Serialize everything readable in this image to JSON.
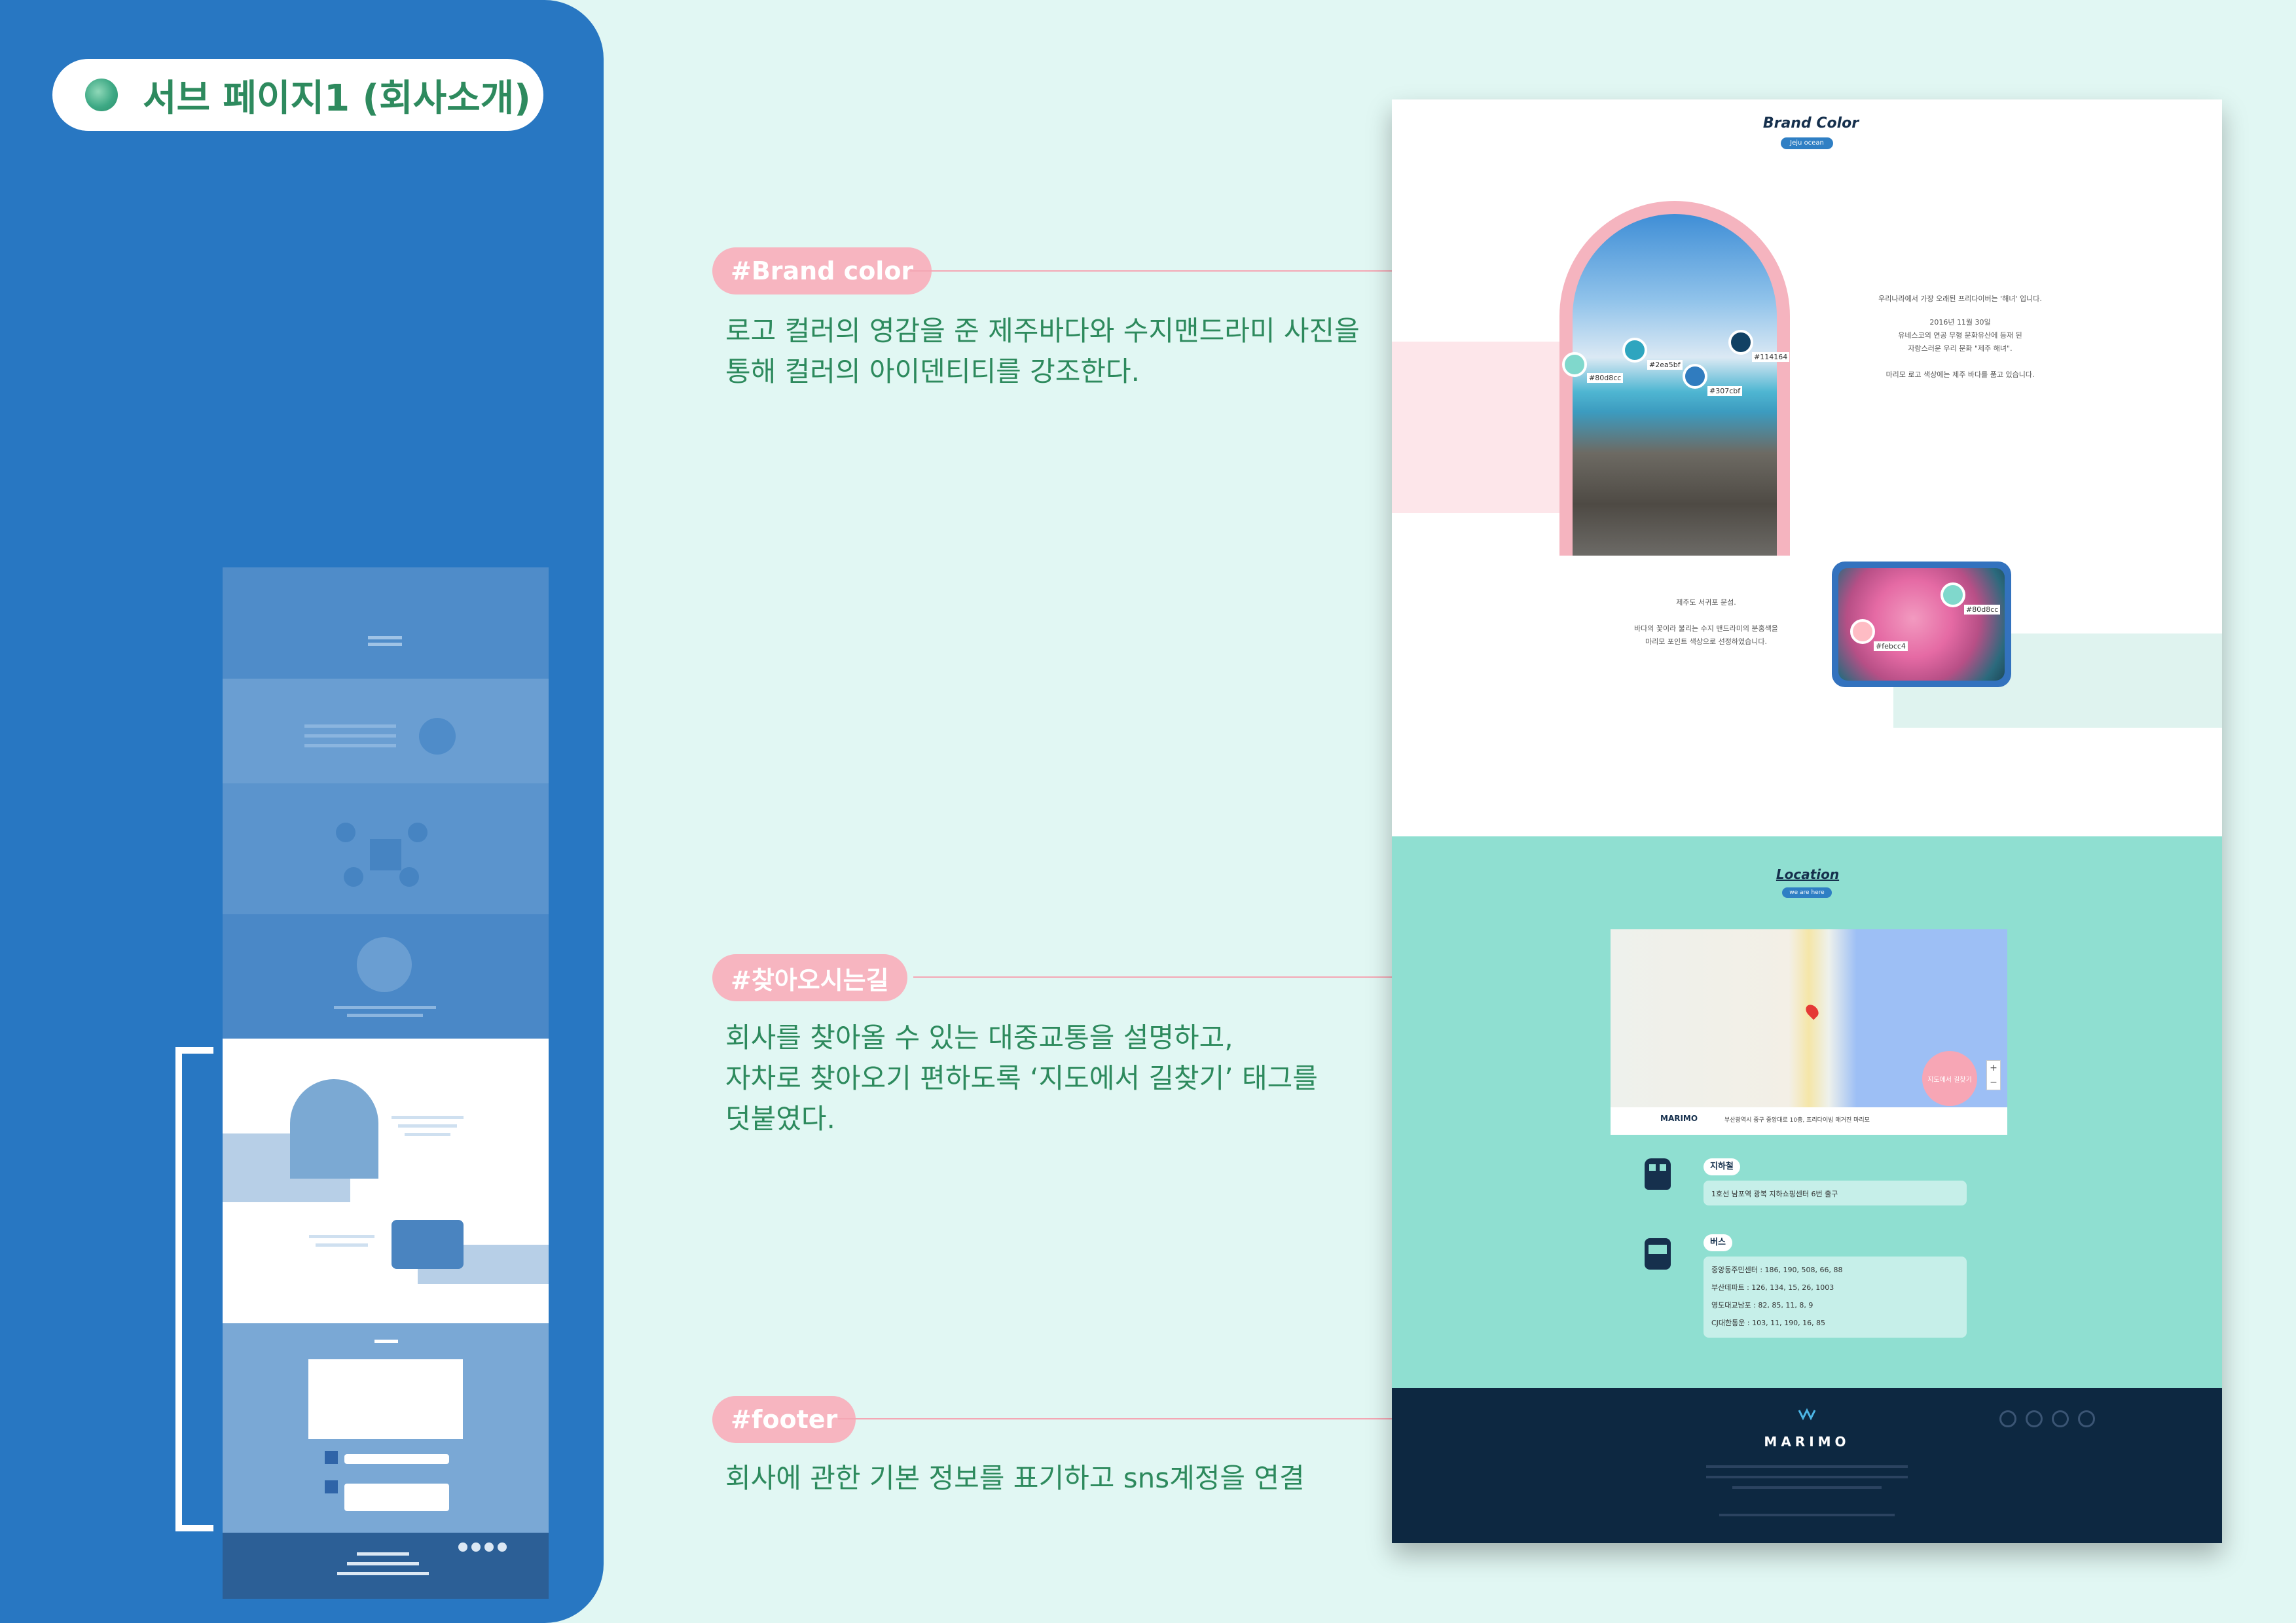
{
  "page_title": "서브 페이지1 (회사소개)",
  "annotations": [
    {
      "tag": "#Brand color",
      "desc": [
        "로고 컬러의 영감을 준 제주바다와 수지맨드라미 사진을",
        "통해 컬러의 아이덴티티를 강조한다."
      ]
    },
    {
      "tag": "#찾아오시는길",
      "desc": [
        "회사를 찾아올 수 있는 대중교통을 설명하고,",
        "자차로 찾아오기 편하도록 ‘지도에서 길찾기’ 태그를",
        "덧붙였다."
      ]
    },
    {
      "tag": "#footer",
      "desc": [
        "회사에 관한 기본 정보를 표기하고 sns계정을 연결"
      ]
    }
  ],
  "mockup": {
    "brand": {
      "title": "Brand Color",
      "badge": "Jeju ocean",
      "text_lines": [
        "우리나라에서 가장 오래된 프리다이버는 '해녀' 입니다.",
        "2016년 11월 30일",
        "유네스코의 연공 무형 문화유산에 등재 된",
        "자랑스러운 우리 문화 \"제주 해녀\".",
        "마리모 로고 색상에는 제주 바다를 품고 있습니다."
      ],
      "swatches": [
        {
          "label": "#80d8cc",
          "color": "#80d8cc"
        },
        {
          "label": "#2ea5bf",
          "color": "#2ea5bf"
        },
        {
          "label": "#307cbf",
          "color": "#307cbf"
        },
        {
          "label": "#114164",
          "color": "#114164"
        }
      ],
      "coral_text": [
        "제주도 서귀포 문섬.",
        "바다의 꽃이라 불리는 수지 맨드라미의 분홍색을",
        "마리모 포인트 색상으로 선정하였습니다."
      ],
      "coral_swatches": [
        {
          "label": "#80d8cc",
          "color": "#80d8cc"
        },
        {
          "label": "#febcc4",
          "color": "#febcc4"
        }
      ]
    },
    "location": {
      "title": "Location",
      "badge": "we are here",
      "map_brand": "MARIMO",
      "map_address": "부산광역시 중구 중앙대로 10층, 프리다이빙 매거진 마리모",
      "map_button": "지도에서 길찾기",
      "subway_label": "지하철",
      "subway_lines": [
        "1호선 남포역 광복 지하쇼핑센터 6번 출구"
      ],
      "bus_label": "버스",
      "bus_lines": [
        "중앙동주민센터 : 186, 190, 508, 66, 88",
        "부산데파트 : 126, 134, 15, 26, 1003",
        "영도대교남포 : 82, 85, 11, 8, 9",
        "CJ대한통운 : 103, 11, 190, 16, 85"
      ]
    },
    "footer": {
      "logo": "MARIMO"
    }
  },
  "colors": {
    "panel_blue": "#2877c2",
    "mint_bg": "#e1f7f3",
    "accent_pink": "#f7b5c0",
    "green_text": "#2d8a5d",
    "location_mint": "#8fdfd1",
    "footer_navy": "#0d2841"
  }
}
